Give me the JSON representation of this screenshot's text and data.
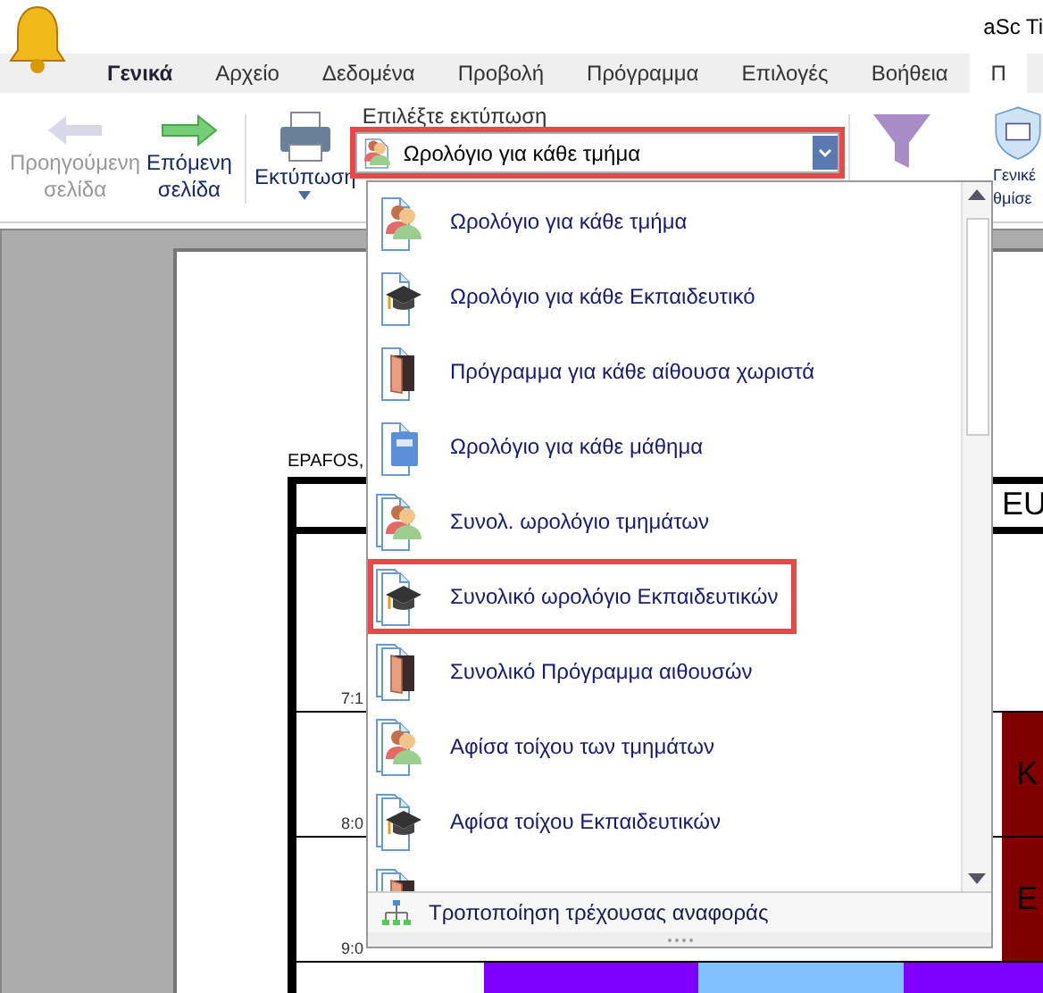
{
  "window": {
    "title": "aSc Ti"
  },
  "tabs": [
    {
      "label": "Γενικά",
      "selected": false,
      "bold": true
    },
    {
      "label": "Αρχείο",
      "selected": false,
      "bold": false
    },
    {
      "label": "Δεδομένα",
      "selected": false,
      "bold": false
    },
    {
      "label": "Προβολή",
      "selected": false,
      "bold": false
    },
    {
      "label": "Πρόγραμμα",
      "selected": false,
      "bold": false
    },
    {
      "label": "Επιλογές",
      "selected": false,
      "bold": false
    },
    {
      "label": "Βοήθεια",
      "selected": false,
      "bold": false
    },
    {
      "label": "Π",
      "selected": true,
      "bold": false
    }
  ],
  "ribbon": {
    "previous": {
      "label": "Προηγούμενη σελίδα",
      "disabled": true
    },
    "next": {
      "label": "Επόμενη σελίδα",
      "disabled": false
    },
    "print": {
      "label": "Εκτύπωση"
    },
    "print_select": {
      "label": "Επιλέξτε εκτύπωση",
      "value": "Ωρολόγιο για κάθε τμήμα",
      "highlighted": true
    },
    "settings": {
      "label_1": "Γενικέ",
      "label_2": "θμίσε"
    }
  },
  "preview": {
    "title": "EPAFOS,",
    "last_header": "EU",
    "rows": [
      {
        "time": "7:1",
        "cells": [
          null,
          null,
          null,
          null
        ]
      },
      {
        "time": "8:0",
        "cells": [
          null,
          null,
          null,
          {
            "text": "K",
            "color": "#800000"
          }
        ]
      },
      {
        "time": "9:0",
        "cells": [
          null,
          null,
          null,
          {
            "text": "E",
            "color": "#800000"
          }
        ]
      },
      {
        "cells": [
          {
            "color": "#8000ff"
          },
          {
            "color": "#80c0ff"
          },
          {
            "color": "#8000ff"
          },
          {
            "color": "#8000ff"
          }
        ]
      }
    ]
  },
  "dropdown": {
    "items": [
      {
        "label": "Ωρολόγιο για κάθε τμήμα",
        "kind": "people",
        "stacked": false,
        "highlighted": false
      },
      {
        "label": "Ωρολόγιο για κάθε Εκπαιδευτικό",
        "kind": "cap",
        "stacked": false,
        "highlighted": false
      },
      {
        "label": "Πρόγραμμα για κάθε αίθουσα χωριστά",
        "kind": "door",
        "stacked": false,
        "highlighted": false
      },
      {
        "label": "Ωρολόγιο για κάθε μάθημα",
        "kind": "book",
        "stacked": false,
        "highlighted": false
      },
      {
        "label": "Συνολ. ωρολόγιο τμημάτων",
        "kind": "people",
        "stacked": true,
        "highlighted": false
      },
      {
        "label": "Συνολικό ωρολόγιο Εκπαιδευτικών",
        "kind": "cap",
        "stacked": true,
        "highlighted": true
      },
      {
        "label": "Συνολικό Πρόγραμμα αιθουσών",
        "kind": "door",
        "stacked": true,
        "highlighted": false
      },
      {
        "label": "Αφίσα τοίχου των τμημάτων",
        "kind": "people",
        "stacked": true,
        "highlighted": false
      },
      {
        "label": "Αφίσα τοίχου Εκπαιδευτικών",
        "kind": "cap",
        "stacked": true,
        "highlighted": false
      },
      {
        "kind": "door",
        "stacked": true,
        "highlighted": false
      }
    ],
    "footer": "Τροποποίηση τρέχουσας αναφοράς"
  }
}
